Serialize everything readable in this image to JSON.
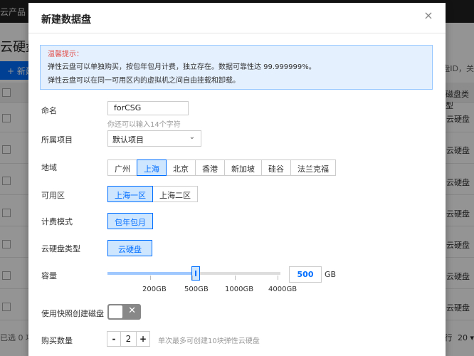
{
  "background": {
    "topbar_product": "云产品 ▾",
    "page_title": "云硬盘",
    "new_button": "+ 新建",
    "search_hint": "盘ID，关",
    "column_header": "磁盘类型",
    "row_value": "云硬盘",
    "footer_left": "已选 0 项",
    "footer_right_text": "行",
    "footer_right_count": "20 ▾"
  },
  "modal": {
    "title": "新建数据盘",
    "close_icon": "×",
    "tip": {
      "title": "温馨提示：",
      "line1": "弹性云盘可以单独购买，按包年包月计费，独立存在。数据可靠性达 99.999999%。",
      "line2": "弹性云盘可以在同一可用区内的虚拟机之间自由挂载和卸载。"
    },
    "name": {
      "label": "命名",
      "value": "forCSG",
      "hint": "你还可以输入14个字符"
    },
    "project": {
      "label": "所属项目",
      "selected": "默认项目"
    },
    "region": {
      "label": "地域",
      "options": [
        "广州",
        "上海",
        "北京",
        "香港",
        "新加坡",
        "硅谷",
        "法兰克福"
      ],
      "selected": "上海"
    },
    "zone": {
      "label": "可用区",
      "options": [
        "上海一区",
        "上海二区"
      ],
      "selected": "上海一区"
    },
    "billing": {
      "label": "计费模式",
      "options": [
        "包年包月"
      ],
      "selected": "包年包月"
    },
    "disk_type": {
      "label": "云硬盘类型",
      "options": [
        "云硬盘"
      ],
      "selected": "云硬盘"
    },
    "capacity": {
      "label": "容量",
      "ticks": [
        "200GB",
        "500GB",
        "1000GB",
        "4000GB"
      ],
      "value": "500",
      "unit": "GB"
    },
    "snapshot": {
      "label": "使用快照创建磁盘",
      "enabled": false,
      "off_icon": "✕"
    },
    "quantity": {
      "label": "购买数量",
      "minus": "-",
      "value": "2",
      "plus": "+",
      "hint": "单次最多可创建10块弹性云硬盘"
    }
  }
}
